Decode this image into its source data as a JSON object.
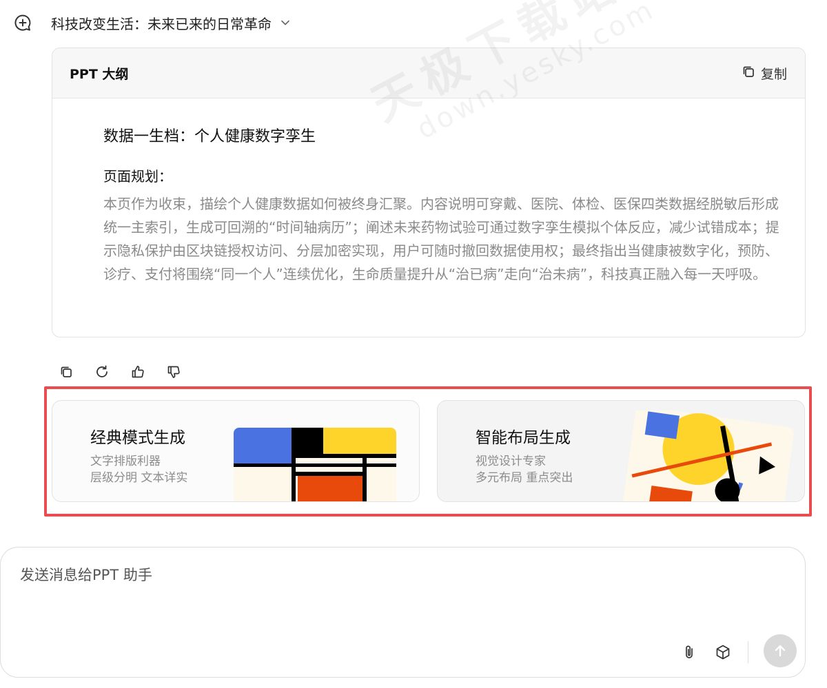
{
  "header": {
    "chat_title": "科技改变生活：未来已来的日常革命"
  },
  "outline": {
    "label": "PPT 大纲",
    "copy_label": "复制",
    "slide_title": "数据一生档：个人健康数字孪生",
    "plan_label": "页面规划：",
    "plan_text": "本页作为收束，描绘个人健康数据如何被终身汇聚。内容说明可穿戴、医院、体检、医保四类数据经脱敏后形成统一主索引，生成可回溯的“时间轴病历”；阐述未来药物试验可通过数字孪生模拟个体反应，减少试错成本；提示隐私保护由区块链授权访问、分层加密实现，用户可随时撤回数据使用权；最终指出当健康被数字化，预防、诊疗、支付将围绕“同一个人”连续优化，生命质量提升从“治已病”走向“治未病”，科技真正融入每一天呼吸。"
  },
  "watermark": {
    "main": "天极下载站",
    "sub": "down.yesky.com"
  },
  "modes": [
    {
      "title": "经典模式生成",
      "line1": "文字排版利器",
      "line2": "层级分明 文本详实"
    },
    {
      "title": "智能布局生成",
      "line1": "视觉设计专家",
      "line2": "多元布局 重点突出"
    }
  ],
  "composer": {
    "placeholder": "发送消息给PPT 助手"
  },
  "icons": {
    "new_chat": "chat-plus-icon",
    "chevron": "chevron-down-icon",
    "copy": "copy-icon",
    "regenerate": "refresh-icon",
    "like": "thumbs-up-icon",
    "dislike": "thumbs-down-icon",
    "attach": "paperclip-icon",
    "cube": "cube-icon",
    "send": "arrow-up-icon"
  },
  "colors": {
    "highlight": "#ea4d4f",
    "mondrian_blue": "#4a72e0",
    "mondrian_yellow": "#fed42b",
    "mondrian_red": "#e84a0c"
  }
}
